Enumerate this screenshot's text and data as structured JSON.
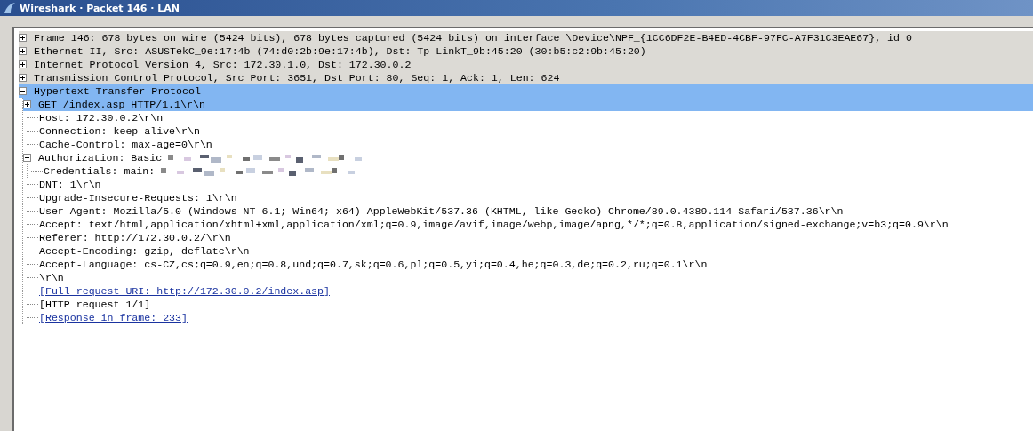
{
  "window": {
    "title": "Wireshark · Packet 146 · LAN"
  },
  "tree": [
    {
      "kind": "protocol",
      "text": "Frame 146: 678 bytes on wire (5424 bits), 678 bytes captured (5424 bits) on interface \\Device\\NPF_{1CC6DF2E-B4ED-4CBF-97FC-A7F31C3EAE67}, id 0",
      "expanded": false,
      "highlighted": false
    },
    {
      "kind": "protocol",
      "text": "Ethernet II, Src: ASUSTekC_9e:17:4b (74:d0:2b:9e:17:4b), Dst: Tp-LinkT_9b:45:20 (30:b5:c2:9b:45:20)",
      "expanded": false,
      "highlighted": false
    },
    {
      "kind": "protocol",
      "text": "Internet Protocol Version 4, Src: 172.30.1.0, Dst: 172.30.0.2",
      "expanded": false,
      "highlighted": false
    },
    {
      "kind": "protocol",
      "text": "Transmission Control Protocol, Src Port: 3651, Dst Port: 80, Seq: 1, Ack: 1, Len: 624",
      "expanded": false,
      "highlighted": false
    },
    {
      "kind": "protocol",
      "text": "Hypertext Transfer Protocol",
      "expanded": true,
      "highlighted": true,
      "children": [
        {
          "kind": "field",
          "text": "GET /index.asp HTTP/1.1\\r\\n",
          "expanded": false,
          "highlighted": true
        },
        {
          "kind": "field",
          "text": "Host: 172.30.0.2\\r\\n",
          "highlighted": false
        },
        {
          "kind": "field",
          "text": "Connection: keep-alive\\r\\n",
          "highlighted": false
        },
        {
          "kind": "field",
          "text": "Cache-Control: max-age=0\\r\\n",
          "highlighted": false
        },
        {
          "kind": "field",
          "text": "Authorization: Basic",
          "redacted": true,
          "expanded": true,
          "highlighted": false,
          "children": [
            {
              "kind": "field",
              "text": "Credentials: main:",
              "redacted": true,
              "highlighted": false
            }
          ]
        },
        {
          "kind": "field",
          "text": "DNT: 1\\r\\n",
          "highlighted": false
        },
        {
          "kind": "field",
          "text": "Upgrade-Insecure-Requests: 1\\r\\n",
          "highlighted": false
        },
        {
          "kind": "field",
          "text": "User-Agent: Mozilla/5.0 (Windows NT 6.1; Win64; x64) AppleWebKit/537.36 (KHTML, like Gecko) Chrome/89.0.4389.114 Safari/537.36\\r\\n",
          "highlighted": false
        },
        {
          "kind": "field",
          "text": "Accept: text/html,application/xhtml+xml,application/xml;q=0.9,image/avif,image/webp,image/apng,*/*;q=0.8,application/signed-exchange;v=b3;q=0.9\\r\\n",
          "highlighted": false
        },
        {
          "kind": "field",
          "text": "Referer: http://172.30.0.2/\\r\\n",
          "highlighted": false
        },
        {
          "kind": "field",
          "text": "Accept-Encoding: gzip, deflate\\r\\n",
          "highlighted": false
        },
        {
          "kind": "field",
          "text": "Accept-Language: cs-CZ,cs;q=0.9,en;q=0.8,und;q=0.7,sk;q=0.6,pl;q=0.5,yi;q=0.4,he;q=0.3,de;q=0.2,ru;q=0.1\\r\\n",
          "highlighted": false
        },
        {
          "kind": "field",
          "text": "\\r\\n",
          "highlighted": false
        },
        {
          "kind": "link",
          "text": "[Full request URI: http://172.30.0.2/index.asp]",
          "highlighted": false
        },
        {
          "kind": "field",
          "text": "[HTTP request 1/1]",
          "highlighted": false
        },
        {
          "kind": "link",
          "text": "[Response in frame: 233]",
          "highlighted": false
        }
      ]
    }
  ]
}
